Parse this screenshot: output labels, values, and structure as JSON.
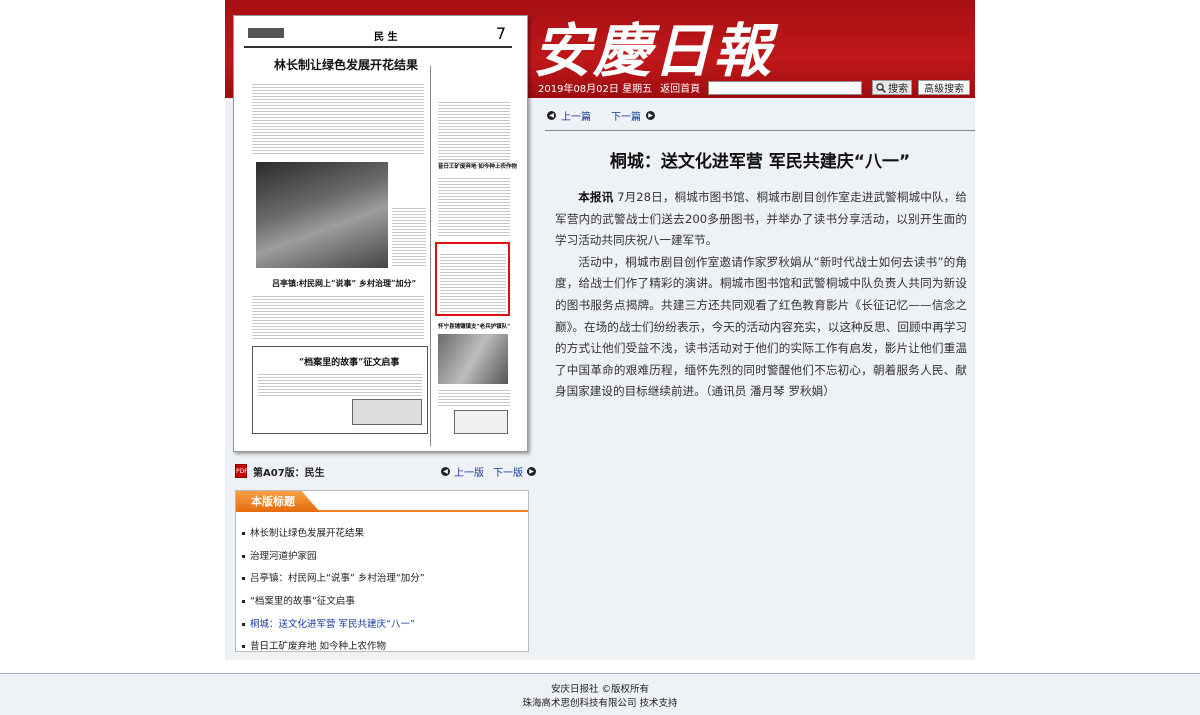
{
  "header": {
    "masthead": "安慶日報",
    "date": "2019年08月02日 星期五",
    "home_link": "返回首頁",
    "search_placeholder": "",
    "search_button": "搜索",
    "advanced_button": "高級搜索"
  },
  "thumbnail": {
    "section": "民 生",
    "page_number": "7",
    "headline": "林长制让绿色发展开花结果",
    "sub1": "吕亭镇:村民网上“说事” 乡村治理“加分”",
    "sub2": "“档案里的故事”征文启事",
    "sub3": "桐城:送文化进军营 军民共建庆“八一”",
    "sub4": "昔日工矿废弃地 如今种上农作物",
    "sub5": "怀宁县铺镶镇支“老兵护镇队”",
    "photo_caption": "治理河道\n护家园"
  },
  "pagenav": {
    "label": "第A07版：民生",
    "prev": "上一版",
    "next": "下一版"
  },
  "headlines_panel": {
    "title": "本版标题",
    "items": [
      "林长制让绿色发展开花结果",
      "治理河道护家园",
      "吕亭镇：村民网上“说事” 乡村治理“加分”",
      "“档案里的故事”征文启事",
      "桐城：送文化进军营 军民共建庆“八一”",
      "昔日工矿废弃地 如今种上农作物"
    ]
  },
  "article": {
    "prev": "上一篇",
    "next": "下一篇",
    "title": "桐城：送文化进军营 军民共建庆“八一”",
    "lead": "本报讯",
    "p1": " 7月28日，桐城市图书馆、桐城市剧目创作室走进武警桐城中队，给军营内的武警战士们送去200多册图书，并举办了读书分享活动，以别开生面的学习活动共同庆祝八一建军节。",
    "p2": "活动中，桐城市剧目创作室邀请作家罗秋娟从“新时代战士如何去读书”的角度，给战士们作了精彩的演讲。桐城市图书馆和武警桐城中队负责人共同为新设的图书服务点揭牌。共建三方还共同观看了红色教育影片《长征记忆——信念之巅》。在场的战士们纷纷表示，今天的活动内容充实，以这种反思、回顾中再学习的方式让他们受益不浅，读书活动对于他们的实际工作有启发，影片让他们重温了中国革命的艰难历程，缅怀先烈的同时警醒他们不忘初心，朝着服务人民、献身国家建设的目标继续前进。（通讯员 潘月琴 罗秋娟）"
  },
  "footer": {
    "line1": "安庆日报社 ©版权所有",
    "line2": "珠海高术思创科技有限公司  技术支持"
  },
  "colors": {
    "banner": "#b8161a",
    "link": "#1a3c9c",
    "panel_accent": "#f58220"
  }
}
